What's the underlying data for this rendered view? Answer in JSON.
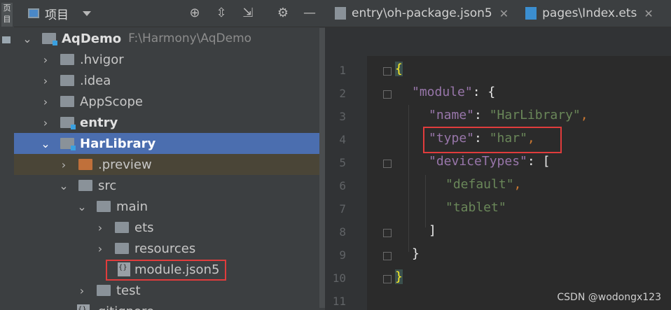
{
  "left_strip": {
    "label": "页目"
  },
  "project": {
    "title": "项目",
    "tools": {
      "locate": "⊕",
      "expand": "⇳",
      "collapse": "⇲",
      "settings": "⚙",
      "hide": "—"
    },
    "tree": [
      {
        "label": "AqDemo",
        "path": "F:\\Harmony\\AqDemo",
        "expanded": true
      },
      {
        "label": ".hvigor"
      },
      {
        "label": ".idea"
      },
      {
        "label": "AppScope"
      },
      {
        "label": "entry"
      },
      {
        "label": "HarLibrary",
        "selected": true
      },
      {
        "label": ".preview"
      },
      {
        "label": "src"
      },
      {
        "label": "main"
      },
      {
        "label": "ets"
      },
      {
        "label": "resources"
      },
      {
        "label": "module.json5",
        "highlighted": true
      },
      {
        "label": "test"
      },
      {
        "label": ".gitignore"
      }
    ]
  },
  "editor": {
    "tabs": [
      {
        "label": "entry\\oh-package.json5",
        "close": "✕"
      },
      {
        "label": "pages\\Index.ets",
        "close": "✕"
      }
    ],
    "line_numbers": [
      "1",
      "2",
      "3",
      "4",
      "5",
      "6",
      "7",
      "8",
      "9",
      "10",
      "11"
    ],
    "code": {
      "l1": "{",
      "l2_key": "\"module\"",
      "l2_rest": ": {",
      "l3_key": "\"name\"",
      "l3_colon": ": ",
      "l3_val": "\"HarLibrary\"",
      "l3_comma": ",",
      "l4_key": "\"type\"",
      "l4_colon": ": ",
      "l4_val": "\"har\"",
      "l4_comma": ",",
      "l5_key": "\"deviceTypes\"",
      "l5_rest": ": [",
      "l6_val": "\"default\"",
      "l6_comma": ",",
      "l7_val": "\"tablet\"",
      "l8": "]",
      "l9": "}",
      "l10": "}"
    }
  },
  "watermark": "CSDN @wodongx123",
  "colors": {
    "selection": "#4b6eaf",
    "annotation_box": "#e03c3c",
    "key": "#9876aa",
    "string": "#6a8759"
  }
}
